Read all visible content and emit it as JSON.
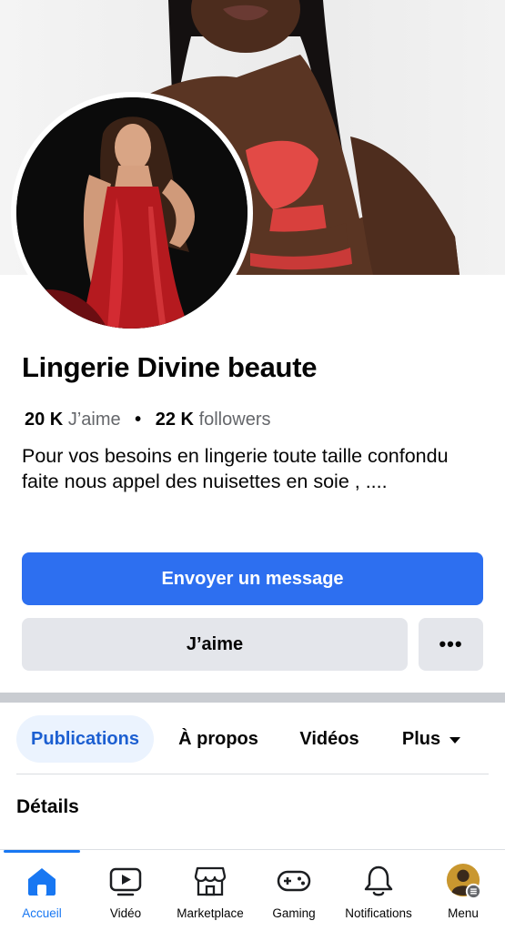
{
  "profile": {
    "name": "Lingerie Divine beaute",
    "likes_count": "20 K",
    "likes_label": "J’aime",
    "followers_count": "22 K",
    "followers_label": "followers",
    "separator": "•",
    "bio": "Pour vos besoins en lingerie toute taille confondu faite nous appel des nuisettes en soie , ...."
  },
  "actions": {
    "message_label": "Envoyer un message",
    "like_label": "J’aime",
    "more_label": "•••"
  },
  "tabs": [
    {
      "label": "Publications",
      "active": true
    },
    {
      "label": "À propos",
      "active": false
    },
    {
      "label": "Vidéos",
      "active": false
    },
    {
      "label": "Plus",
      "active": false
    }
  ],
  "section": {
    "title": "Détails"
  },
  "bottom_nav": [
    {
      "label": "Accueil",
      "icon": "home-icon",
      "active": true
    },
    {
      "label": "Vidéo",
      "icon": "video-icon",
      "active": false
    },
    {
      "label": "Marketplace",
      "icon": "marketplace-icon",
      "active": false
    },
    {
      "label": "Gaming",
      "icon": "gaming-icon",
      "active": false
    },
    {
      "label": "Notifications",
      "icon": "bell-icon",
      "active": false
    },
    {
      "label": "Menu",
      "icon": "avatar-menu-icon",
      "active": false
    }
  ],
  "colors": {
    "primary_blue": "#2d6ff0",
    "accent_blue": "#1877f2",
    "secondary_button": "#e4e6eb",
    "active_tab_bg": "#ebf3fe",
    "muted_text": "#65676b"
  }
}
